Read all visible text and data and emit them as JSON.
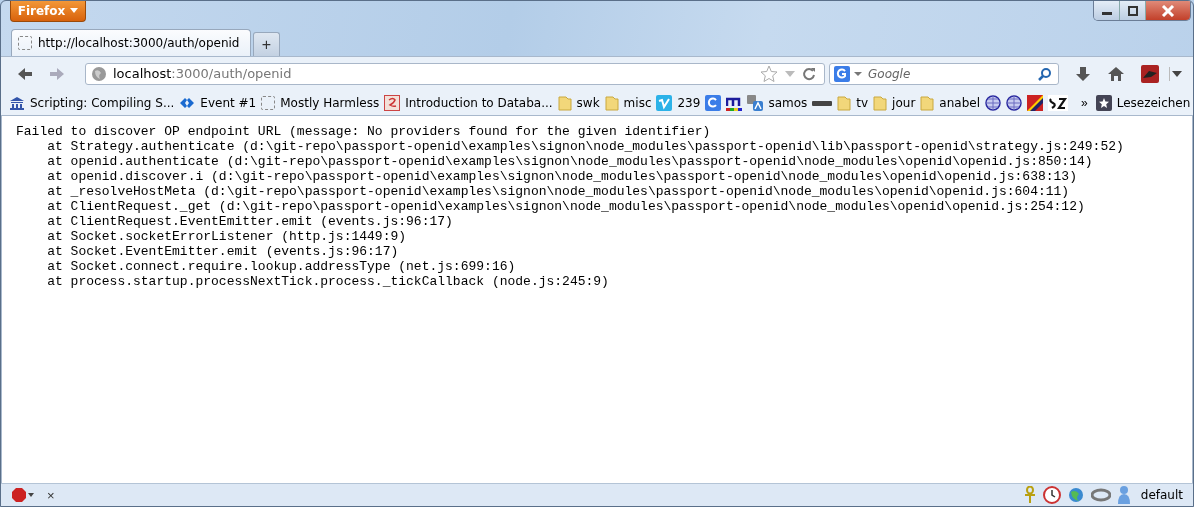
{
  "window": {
    "app_button": "Firefox"
  },
  "tabs": [
    {
      "label": "http://localhost:3000/auth/openid",
      "selected": true
    }
  ],
  "new_tab": "+",
  "address_bar": {
    "host": "localhost",
    "path": ":3000/auth/openid"
  },
  "search": {
    "placeholder": "Google"
  },
  "bookmarks": [
    {
      "kind": "temple",
      "label": "Scripting: Compiling S..."
    },
    {
      "kind": "diamond",
      "label": "Event #1"
    },
    {
      "kind": "blank",
      "label": "Mostly Harmless"
    },
    {
      "kind": "document",
      "label": "Introduction to Databa..."
    },
    {
      "kind": "folder",
      "label": "swk"
    },
    {
      "kind": "folder",
      "label": "misc"
    },
    {
      "kind": "vimeo",
      "label": "239"
    },
    {
      "kind": "square"
    },
    {
      "kind": "bars"
    },
    {
      "kind": "translate",
      "label": "samos"
    },
    {
      "kind": "grey"
    },
    {
      "kind": "folder",
      "label": "tv"
    },
    {
      "kind": "folder",
      "label": "jour"
    },
    {
      "kind": "folder",
      "label": "anabel"
    },
    {
      "kind": "globe"
    },
    {
      "kind": "globe"
    },
    {
      "kind": "flag"
    },
    {
      "kind": "paper"
    }
  ],
  "bookmarks_overflow": "»",
  "bookmarks_menu": "Lesezeichen",
  "content_lines": [
    "Failed to discover OP endpoint URL (message: No providers found for the given identifier)",
    "    at Strategy.authenticate (d:\\git-repo\\passport-openid\\examples\\signon\\node_modules\\passport-openid\\lib\\passport-openid\\strategy.js:249:52)",
    "    at openid.authenticate (d:\\git-repo\\passport-openid\\examples\\signon\\node_modules\\passport-openid\\node_modules\\openid\\openid.js:850:14)",
    "    at openid.discover.i (d:\\git-repo\\passport-openid\\examples\\signon\\node_modules\\passport-openid\\node_modules\\openid\\openid.js:638:13)",
    "    at _resolveHostMeta (d:\\git-repo\\passport-openid\\examples\\signon\\node_modules\\passport-openid\\node_modules\\openid\\openid.js:604:11)",
    "    at ClientRequest._get (d:\\git-repo\\passport-openid\\examples\\signon\\node_modules\\passport-openid\\node_modules\\openid\\openid.js:254:12)",
    "    at ClientRequest.EventEmitter.emit (events.js:96:17)",
    "    at Socket.socketErrorListener (http.js:1449:9)",
    "    at Socket.EventEmitter.emit (events.js:96:17)",
    "    at Socket.connect.require.lookup.addressType (net.js:699:16)",
    "    at process.startup.processNextTick.process._tickCallback (node.js:245:9)"
  ],
  "status_bar": {
    "close": "×",
    "profile": "default"
  }
}
